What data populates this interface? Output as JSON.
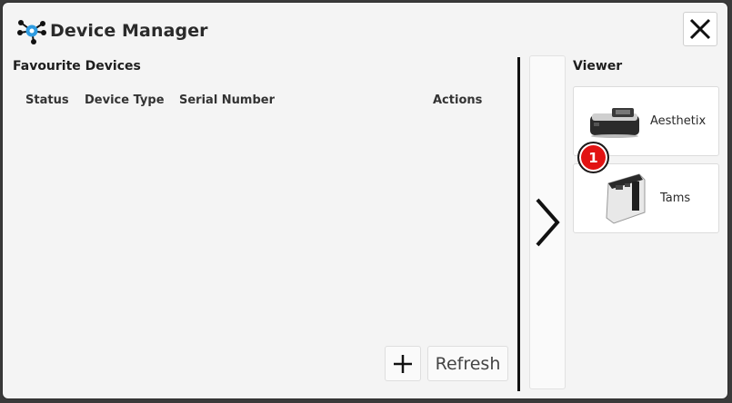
{
  "window": {
    "title": "Device Manager"
  },
  "icons": {
    "logo": "device-network-icon",
    "close": "close-icon",
    "add": "plus-icon",
    "expand": "chevron-right-icon"
  },
  "favourites": {
    "title": "Favourite Devices",
    "columns": [
      "Status",
      "Device Type",
      "Serial Number",
      "Actions"
    ],
    "rows": [],
    "refresh_label": "Refresh"
  },
  "viewer": {
    "title": "Viewer",
    "devices": [
      {
        "name": "Aesthetix"
      },
      {
        "name": "Tams"
      }
    ],
    "badge": "1"
  },
  "colors": {
    "accent": "#2e9be0",
    "badge": "#e21313"
  }
}
